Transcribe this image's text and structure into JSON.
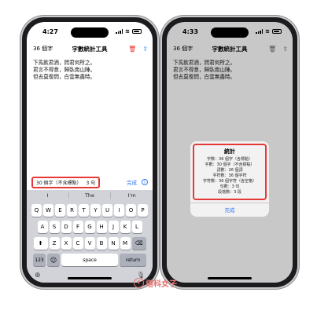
{
  "left": {
    "time": "4:27",
    "count_label": "36 個字",
    "title": "字數統計工具",
    "text_lines": [
      "下馬飲君酒，問君何所之。",
      "君言不得意，歸臥南山陲。",
      "但去莫復問，白雲無盡時。"
    ],
    "count_pill_chars": "30 個字（不含標點）",
    "count_pill_sentences": "3 句",
    "done_label": "完成",
    "info_label": "i",
    "predictions": [
      "I",
      "The",
      "I'm"
    ],
    "rows": [
      [
        "Q",
        "W",
        "E",
        "R",
        "T",
        "Y",
        "U",
        "I",
        "O",
        "P"
      ],
      [
        "A",
        "S",
        "D",
        "F",
        "G",
        "H",
        "J",
        "K",
        "L"
      ],
      [
        "Z",
        "X",
        "C",
        "V",
        "B",
        "N",
        "M"
      ]
    ],
    "shift_label": "⬆",
    "delete_label": "⌫",
    "num_label": "123",
    "emoji_label": "☺",
    "space_label": "space",
    "return_label": "return",
    "globe_label": "⊕",
    "mic_label": "🎙"
  },
  "right": {
    "time": "4:33",
    "count_label": "36 個字",
    "title": "字數統計工具",
    "text_lines": [
      "下馬飲君酒，問君何所之。",
      "君言不得意，歸臥南山陲。",
      "但去莫復問，白雲無盡時。"
    ],
    "modal_title": "統計",
    "modal_lines": [
      "字數：36 個字（含標點）",
      "字數：30 個字（不含標點）",
      "詞數：26 個詞",
      "字符數：36 個字符",
      "字符數：36 個字符（含空格）",
      "句數：3 句",
      "段落數：3 段"
    ],
    "modal_button": "完成"
  },
  "watermark": "塔科女子",
  "watermark_mark": "T"
}
